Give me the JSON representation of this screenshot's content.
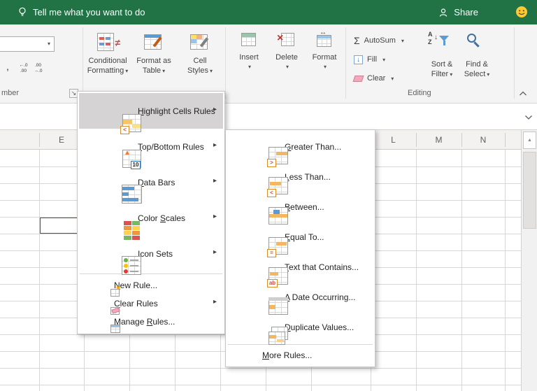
{
  "colors": {
    "titlebar_green": "#217346",
    "selection_green": "#1e7145",
    "menu_highlight": "#d5d3d3"
  },
  "titlebar": {
    "tell_me": "Tell me what you want to do",
    "share": "Share"
  },
  "ribbon": {
    "number_group": {
      "comma": ",",
      "inc_top": "←.0",
      "inc_bottom": ".00",
      "dec_top": ".00",
      "dec_bottom": "→.0",
      "label_partial": "mber"
    },
    "styles_group": {
      "cf1": "Conditional",
      "cf2": "Formatting",
      "fat1": "Format as",
      "fat2": "Table",
      "cs1": "Cell",
      "cs2": "Styles"
    },
    "cells_group": {
      "insert": "Insert",
      "delete": "Delete",
      "format": "Format"
    },
    "editing_group": {
      "autosum": "AutoSum",
      "fill": "Fill",
      "clear": "Clear",
      "sort1": "Sort &",
      "sort2": "Filter",
      "find1": "Find &",
      "find2": "Select",
      "label": "Editing"
    }
  },
  "glyphs": {
    "dropdown_arrow": "▾",
    "submenu_arrow": "▸",
    "scroll_up": "▲",
    "sigma": "Σ",
    "dialog_launcher": "↘",
    "sort_a": "A",
    "sort_z": "Z",
    "sort_down": "↓",
    "not_equal": "≠",
    "fill_arrow": "↓",
    "format_arrows": "↔",
    "delete_x": "×",
    "ten": "10",
    "up_triangle": "▲",
    "star": "★"
  },
  "cf_menu": {
    "items": [
      {
        "pre": "",
        "key": "H",
        "post": "ighlight Cells Rules",
        "highlighted": true
      },
      {
        "pre": "",
        "key": "T",
        "post": "op/Bottom Rules"
      },
      {
        "pre": "",
        "key": "D",
        "post": "ata Bars"
      },
      {
        "pre": "Color ",
        "key": "S",
        "post": "cales"
      },
      {
        "pre": "",
        "key": "I",
        "post": "con Sets"
      }
    ],
    "small_items": [
      {
        "pre": "",
        "key": "N",
        "post": "ew Rule..."
      },
      {
        "pre": "",
        "key": "C",
        "post": "lear Rules"
      },
      {
        "pre": "Manage ",
        "key": "R",
        "post": "ules..."
      }
    ]
  },
  "submenu": {
    "items": [
      {
        "pre": "",
        "key": "G",
        "post": "reater Than...",
        "glyph": ">"
      },
      {
        "pre": "",
        "key": "L",
        "post": "ess Than...",
        "glyph": "<"
      },
      {
        "pre": "",
        "key": "B",
        "post": "etween..."
      },
      {
        "pre": "",
        "key": "E",
        "post": "qual To...",
        "glyph": "="
      },
      {
        "pre": "",
        "key": "T",
        "post": "ext that Contains...",
        "glyph": "ab"
      },
      {
        "pre": "",
        "key": "A",
        "post": " Date Occurring..."
      },
      {
        "pre": "",
        "key": "D",
        "post": "uplicate Values..."
      },
      {
        "pre": "More ",
        "key": "M",
        "post": ""
      }
    ],
    "more_rules": {
      "pre": "",
      "key": "M",
      "post": "ore Rules..."
    }
  },
  "sheet": {
    "columns": [
      "E",
      "L",
      "M",
      "N"
    ]
  }
}
